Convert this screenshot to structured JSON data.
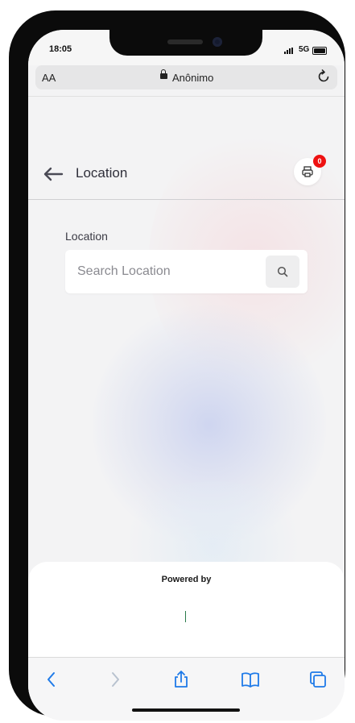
{
  "status_bar": {
    "time": "18:05",
    "network": "5G"
  },
  "browser": {
    "text_size_label": "AA",
    "page_title": "Anônimo"
  },
  "header": {
    "title": "Location",
    "cart_count": "0"
  },
  "location_field": {
    "label": "Location",
    "placeholder": "Search Location",
    "value": ""
  },
  "footer": {
    "powered_by": "Powered by"
  },
  "icons": {
    "back": "arrow-left-icon",
    "print": "printer-icon",
    "search": "search-icon",
    "toolbar": [
      "chevron-left-icon",
      "chevron-right-icon",
      "share-icon",
      "book-icon",
      "tabs-icon"
    ]
  },
  "colors": {
    "accent_blue": "#1e7ae8",
    "badge_red": "#ee1111",
    "text_dark": "#2f2f3a"
  }
}
